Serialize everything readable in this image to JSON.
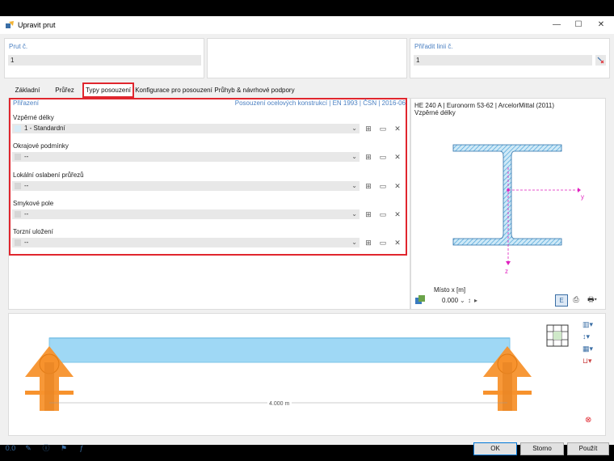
{
  "window": {
    "title": "Upravit prut",
    "minimize": "—",
    "maximize": "☐",
    "close": "✕"
  },
  "header": {
    "member_label": "Prut č.",
    "member_value": "1",
    "line_label": "Přiřadit linii č.",
    "line_value": "1"
  },
  "tabs": [
    {
      "label": "Základní údaje"
    },
    {
      "label": "Průřez"
    },
    {
      "label": "Typy posouzení"
    },
    {
      "label": "Konfigurace pro posouzení"
    },
    {
      "label": "Průhyb & návrhové podpory"
    }
  ],
  "panel": {
    "title": "Přiřazení",
    "standard": "Posouzení ocelových konstrukcí | EN 1993 | ČSN | 2016-06",
    "sections": [
      {
        "label": "Vzpěrné délky",
        "value": "1 - Standardní"
      },
      {
        "label": "Okrajové podmínky",
        "value": "--"
      },
      {
        "label": "Lokální oslabení průřezů",
        "value": "--"
      },
      {
        "label": "Smykové pole",
        "value": "--"
      },
      {
        "label": "Torzní uložení",
        "value": "--"
      }
    ]
  },
  "section_view": {
    "title": "HE 240 A | Euronorm 53-62 | ArcelorMittal (2011)",
    "subtitle": "Vzpěrné délky",
    "axis_y": "y",
    "axis_z": "z",
    "location_label": "Místo x [m]",
    "location_value": "0.000"
  },
  "beam_view": {
    "length_label": "4.000 m"
  },
  "buttons": {
    "ok": "OK",
    "cancel": "Storno",
    "apply": "Použít"
  },
  "colors": {
    "accent_red": "#e0262e",
    "beam_blue": "#9fd8f5",
    "support_orange": "#f7922d",
    "label_blue": "#4a7fc1",
    "axis_magenta": "#e01fbf"
  }
}
